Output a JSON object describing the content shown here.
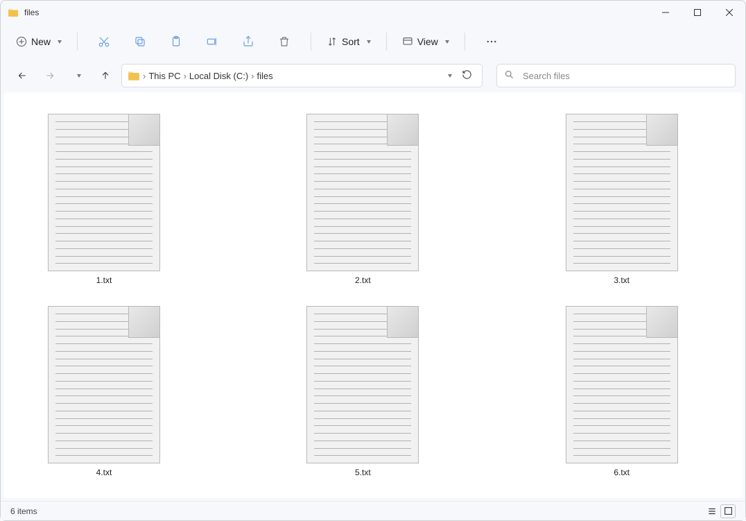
{
  "window": {
    "title": "files"
  },
  "toolbar": {
    "new_label": "New",
    "sort_label": "Sort",
    "view_label": "View"
  },
  "breadcrumb": {
    "seg0": "This PC",
    "seg1": "Local Disk (C:)",
    "seg2": "files"
  },
  "search": {
    "placeholder": "Search files"
  },
  "files": [
    {
      "name": "1.txt"
    },
    {
      "name": "2.txt"
    },
    {
      "name": "3.txt"
    },
    {
      "name": "4.txt"
    },
    {
      "name": "5.txt"
    },
    {
      "name": "6.txt"
    }
  ],
  "status": {
    "text": "6 items"
  }
}
